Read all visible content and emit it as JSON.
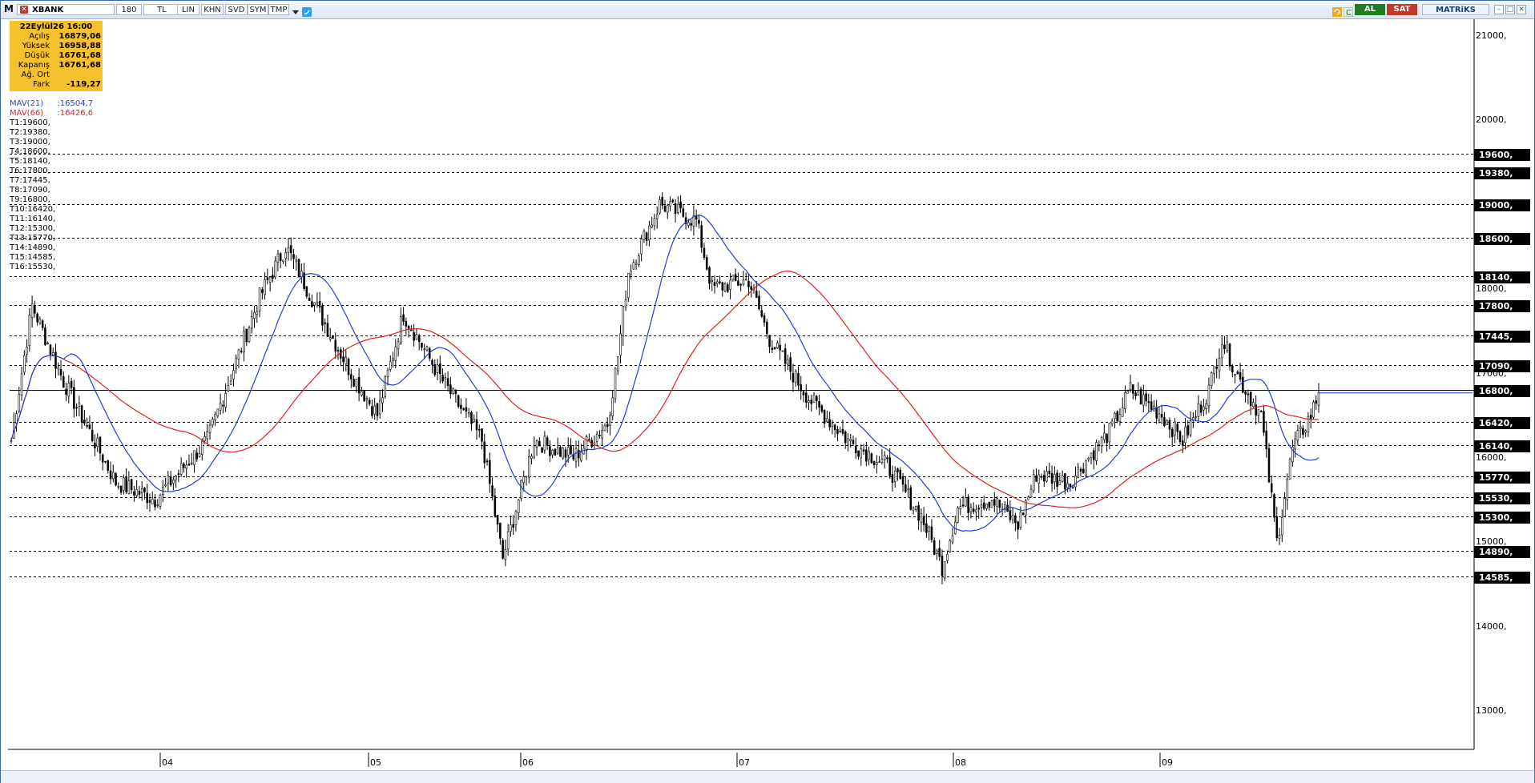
{
  "toolbar": {
    "symbol": "XBANK",
    "period": "180",
    "currency": "TL",
    "scale": "LIN",
    "buttons": [
      "KHN",
      "SVD",
      "SYM",
      "TMP"
    ],
    "buy": "AL",
    "sell": "SAT",
    "brand": "MATRiKS",
    "icons": [
      "m-logo-icon",
      "dropdown-arrow-icon",
      "twitter-icon",
      "refresh-icon",
      "c-icon",
      "minimize-icon",
      "restore-icon",
      "close-icon"
    ]
  },
  "infobox": {
    "datetime": "22Eylül26 16:00",
    "rows": [
      {
        "label": "Açılış",
        "value": "16879,06"
      },
      {
        "label": "Yüksek",
        "value": "16958,88"
      },
      {
        "label": "Düşük",
        "value": "16761,68"
      },
      {
        "label": "Kapanış",
        "value": "16761,68"
      },
      {
        "label": "Ağ. Ort",
        "value": ""
      },
      {
        "label": "Fark",
        "value": "-119,27"
      }
    ]
  },
  "indicators": [
    {
      "name": "MAV(21)",
      "value": ":16504,7",
      "color": "#1f3fd6"
    },
    {
      "name": "MAV(66)",
      "value": ":16426,6",
      "color": "#e02020"
    }
  ],
  "levels": [
    {
      "name": "T1",
      "value": 19600,
      "text": "T1:19600,"
    },
    {
      "name": "T2",
      "value": 19380,
      "text": "T2:19380,"
    },
    {
      "name": "T3",
      "value": 19000,
      "text": "T3:19000,"
    },
    {
      "name": "T4",
      "value": 18600,
      "text": "T4:18600,"
    },
    {
      "name": "T5",
      "value": 18140,
      "text": "T5:18140,"
    },
    {
      "name": "T6",
      "value": 17800,
      "text": "T6:17800,"
    },
    {
      "name": "T7",
      "value": 17445,
      "text": "T7:17445,"
    },
    {
      "name": "T8",
      "value": 17090,
      "text": "T8:17090,"
    },
    {
      "name": "T9",
      "value": 16800,
      "text": "T9:16800,"
    },
    {
      "name": "T10",
      "value": 16420,
      "text": "T10:16420,"
    },
    {
      "name": "T11",
      "value": 16140,
      "text": "T11:16140,"
    },
    {
      "name": "T12",
      "value": 15300,
      "text": "T12:15300,"
    },
    {
      "name": "T13",
      "value": 15770,
      "text": "T13:15770,"
    },
    {
      "name": "T14",
      "value": 14890,
      "text": "T14:14890,"
    },
    {
      "name": "T15",
      "value": 14585,
      "text": "T15:14585,"
    },
    {
      "name": "T16",
      "value": 15530,
      "text": "T16:15530,"
    }
  ],
  "chart_data": {
    "type": "candlestick",
    "y_axis_ticks": [
      21000,
      20000,
      19000,
      18000,
      17000,
      16000,
      15000,
      14000,
      13000
    ],
    "y_axis_tick_labels": [
      "21000,",
      "20000,",
      "19000,",
      "18000,",
      "17000,",
      "16000,",
      "15000,",
      "14000,",
      "13000,"
    ],
    "ylim": [
      12500,
      21200
    ],
    "x_tick_labels": [
      "04",
      "05",
      "06",
      "07",
      "08",
      "09"
    ],
    "level_badges": [
      "19600,",
      "19380,",
      "19000,",
      "18600,",
      "18140,",
      "17800,",
      "17445,",
      "17090,",
      "16800,",
      "16420,",
      "16140,",
      "15770,",
      "15530,",
      "15300,",
      "14890,",
      "14585,"
    ],
    "last_close": 16761.68,
    "ma_current": {
      "MAV(21)": 16504.7,
      "MAV(66)": 16426.6
    },
    "colors": {
      "up_candle": "#ffffff",
      "down_candle": "#000000",
      "ma21": "#1f3fd6",
      "ma66": "#e02020",
      "last_price_line": "#1f3fd6"
    },
    "anchor_closes": [
      {
        "x": 0,
        "close": 16200
      },
      {
        "x": 8,
        "close": 17800
      },
      {
        "x": 20,
        "close": 16900
      },
      {
        "x": 40,
        "close": 15700
      },
      {
        "x": 55,
        "close": 15500
      },
      {
        "x": 75,
        "close": 16200
      },
      {
        "x": 95,
        "close": 17900
      },
      {
        "x": 105,
        "close": 18500
      },
      {
        "x": 118,
        "close": 17700
      },
      {
        "x": 130,
        "close": 17000
      },
      {
        "x": 140,
        "close": 16500
      },
      {
        "x": 150,
        "close": 17700
      },
      {
        "x": 165,
        "close": 16900
      },
      {
        "x": 180,
        "close": 16200
      },
      {
        "x": 188,
        "close": 14800
      },
      {
        "x": 200,
        "close": 16200
      },
      {
        "x": 215,
        "close": 16000
      },
      {
        "x": 228,
        "close": 16400
      },
      {
        "x": 232,
        "close": 17200
      },
      {
        "x": 236,
        "close": 18200
      },
      {
        "x": 248,
        "close": 19000
      },
      {
        "x": 262,
        "close": 18800
      },
      {
        "x": 268,
        "close": 18000
      },
      {
        "x": 282,
        "close": 18100
      },
      {
        "x": 290,
        "close": 17400
      },
      {
        "x": 305,
        "close": 16700
      },
      {
        "x": 320,
        "close": 16200
      },
      {
        "x": 335,
        "close": 15900
      },
      {
        "x": 348,
        "close": 15300
      },
      {
        "x": 356,
        "close": 14700
      },
      {
        "x": 362,
        "close": 15400
      },
      {
        "x": 375,
        "close": 15500
      },
      {
        "x": 385,
        "close": 15200
      },
      {
        "x": 392,
        "close": 15800
      },
      {
        "x": 405,
        "close": 15700
      },
      {
        "x": 412,
        "close": 16000
      },
      {
        "x": 420,
        "close": 16300
      },
      {
        "x": 428,
        "close": 16800
      },
      {
        "x": 440,
        "close": 16500
      },
      {
        "x": 448,
        "close": 16200
      },
      {
        "x": 458,
        "close": 16800
      },
      {
        "x": 463,
        "close": 17400
      },
      {
        "x": 470,
        "close": 16900
      },
      {
        "x": 478,
        "close": 16500
      },
      {
        "x": 484,
        "close": 15000
      },
      {
        "x": 490,
        "close": 16100
      },
      {
        "x": 497,
        "close": 16500
      },
      {
        "x": 500,
        "close": 16760
      }
    ]
  }
}
